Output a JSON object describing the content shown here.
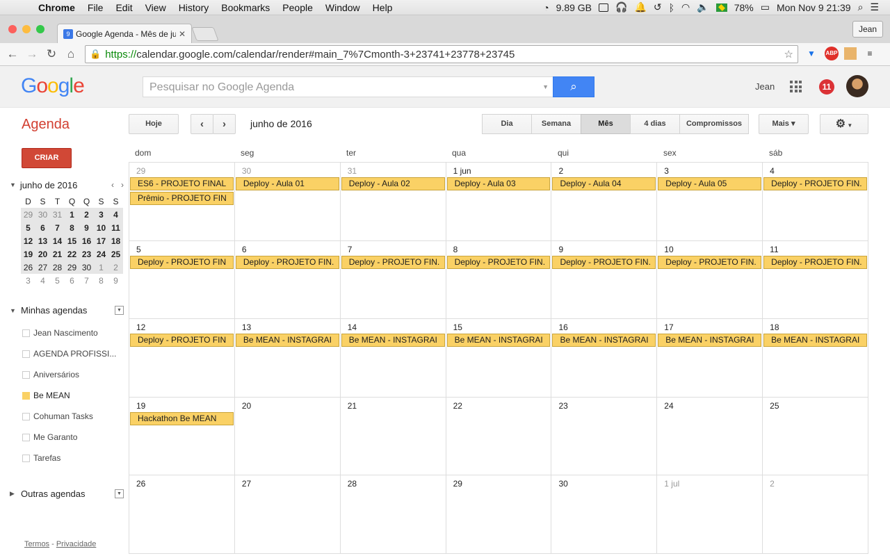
{
  "menubar": {
    "app": "Chrome",
    "items": [
      "File",
      "Edit",
      "View",
      "History",
      "Bookmarks",
      "People",
      "Window",
      "Help"
    ],
    "disk": "9.89 GB",
    "battery": "78%",
    "datetime": "Mon Nov 9  21:39"
  },
  "browser": {
    "tab_title": "Google Agenda - Mês de junho",
    "profile": "Jean",
    "url_https": "https://",
    "url_rest": "calendar.google.com/calendar/render#main_7%7Cmonth-3+23741+23778+23745"
  },
  "header": {
    "search_placeholder": "Pesquisar no Google Agenda",
    "user": "Jean",
    "notifications": "11"
  },
  "toolbar": {
    "app_name": "Agenda",
    "today": "Hoje",
    "period": "junho de 2016",
    "views": [
      "Dia",
      "Semana",
      "Mês",
      "4 dias",
      "Compromissos"
    ],
    "more": "Mais ▾"
  },
  "sidebar": {
    "create": "CRIAR",
    "mini_month": "junho de 2016",
    "mini_days": [
      "D",
      "S",
      "T",
      "Q",
      "Q",
      "S",
      "S"
    ],
    "mini_weeks": [
      [
        "29",
        "30",
        "31",
        "1",
        "2",
        "3",
        "4"
      ],
      [
        "5",
        "6",
        "7",
        "8",
        "9",
        "10",
        "11"
      ],
      [
        "12",
        "13",
        "14",
        "15",
        "16",
        "17",
        "18"
      ],
      [
        "19",
        "20",
        "21",
        "22",
        "23",
        "24",
        "25"
      ],
      [
        "26",
        "27",
        "28",
        "29",
        "30",
        "1",
        "2"
      ],
      [
        "3",
        "4",
        "5",
        "6",
        "7",
        "8",
        "9"
      ]
    ],
    "my_calendars_title": "Minhas agendas",
    "my_calendars": [
      "Jean Nascimento",
      "AGENDA PROFISSI...",
      "Aniversários",
      "Be MEAN",
      "Cohuman Tasks",
      "Me Garanto",
      "Tarefas"
    ],
    "other_calendars_title": "Outras agendas",
    "footer_terms": "Termos",
    "footer_sep": " - ",
    "footer_privacy": "Privacidade"
  },
  "month": {
    "dows": [
      "dom",
      "seg",
      "ter",
      "qua",
      "qui",
      "sex",
      "sáb"
    ],
    "weeks": [
      {
        "days": [
          "29",
          "30",
          "31",
          "1 jun",
          "2",
          "3",
          "4"
        ],
        "events": [
          [
            "ES6 - PROJETO FINAL",
            "Prêmio - PROJETO FIN"
          ],
          [
            "Deploy - Aula 01"
          ],
          [
            "Deploy - Aula 02"
          ],
          [
            "Deploy - Aula 03"
          ],
          [
            "Deploy - Aula 04"
          ],
          [
            "Deploy - Aula 05"
          ],
          [
            "Deploy - PROJETO FIN."
          ]
        ]
      },
      {
        "days": [
          "5",
          "6",
          "7",
          "8",
          "9",
          "10",
          "11"
        ],
        "events": [
          [
            "Deploy - PROJETO FIN"
          ],
          [
            "Deploy - PROJETO FIN."
          ],
          [
            "Deploy - PROJETO FIN."
          ],
          [
            "Deploy - PROJETO FIN."
          ],
          [
            "Deploy - PROJETO FIN."
          ],
          [
            "Deploy - PROJETO FIN."
          ],
          [
            "Deploy - PROJETO FIN."
          ]
        ]
      },
      {
        "days": [
          "12",
          "13",
          "14",
          "15",
          "16",
          "17",
          "18"
        ],
        "events": [
          [
            "Deploy - PROJETO FIN"
          ],
          [
            "Be MEAN - INSTAGRAI"
          ],
          [
            "Be MEAN - INSTAGRAI"
          ],
          [
            "Be MEAN - INSTAGRAI"
          ],
          [
            "Be MEAN - INSTAGRAI"
          ],
          [
            "Be MEAN - INSTAGRAI"
          ],
          [
            "Be MEAN - INSTAGRAI"
          ]
        ]
      },
      {
        "days": [
          "19",
          "20",
          "21",
          "22",
          "23",
          "24",
          "25"
        ],
        "events": [
          [
            "Hackathon Be MEAN"
          ],
          [],
          [],
          [],
          [],
          [],
          []
        ]
      },
      {
        "days": [
          "26",
          "27",
          "28",
          "29",
          "30",
          "1 jul",
          "2"
        ],
        "events": [
          [],
          [],
          [],
          [],
          [],
          [],
          []
        ]
      }
    ]
  },
  "colors": {
    "event": "#fad165",
    "brand_red": "#d23f31",
    "search_blue": "#4285f4"
  }
}
